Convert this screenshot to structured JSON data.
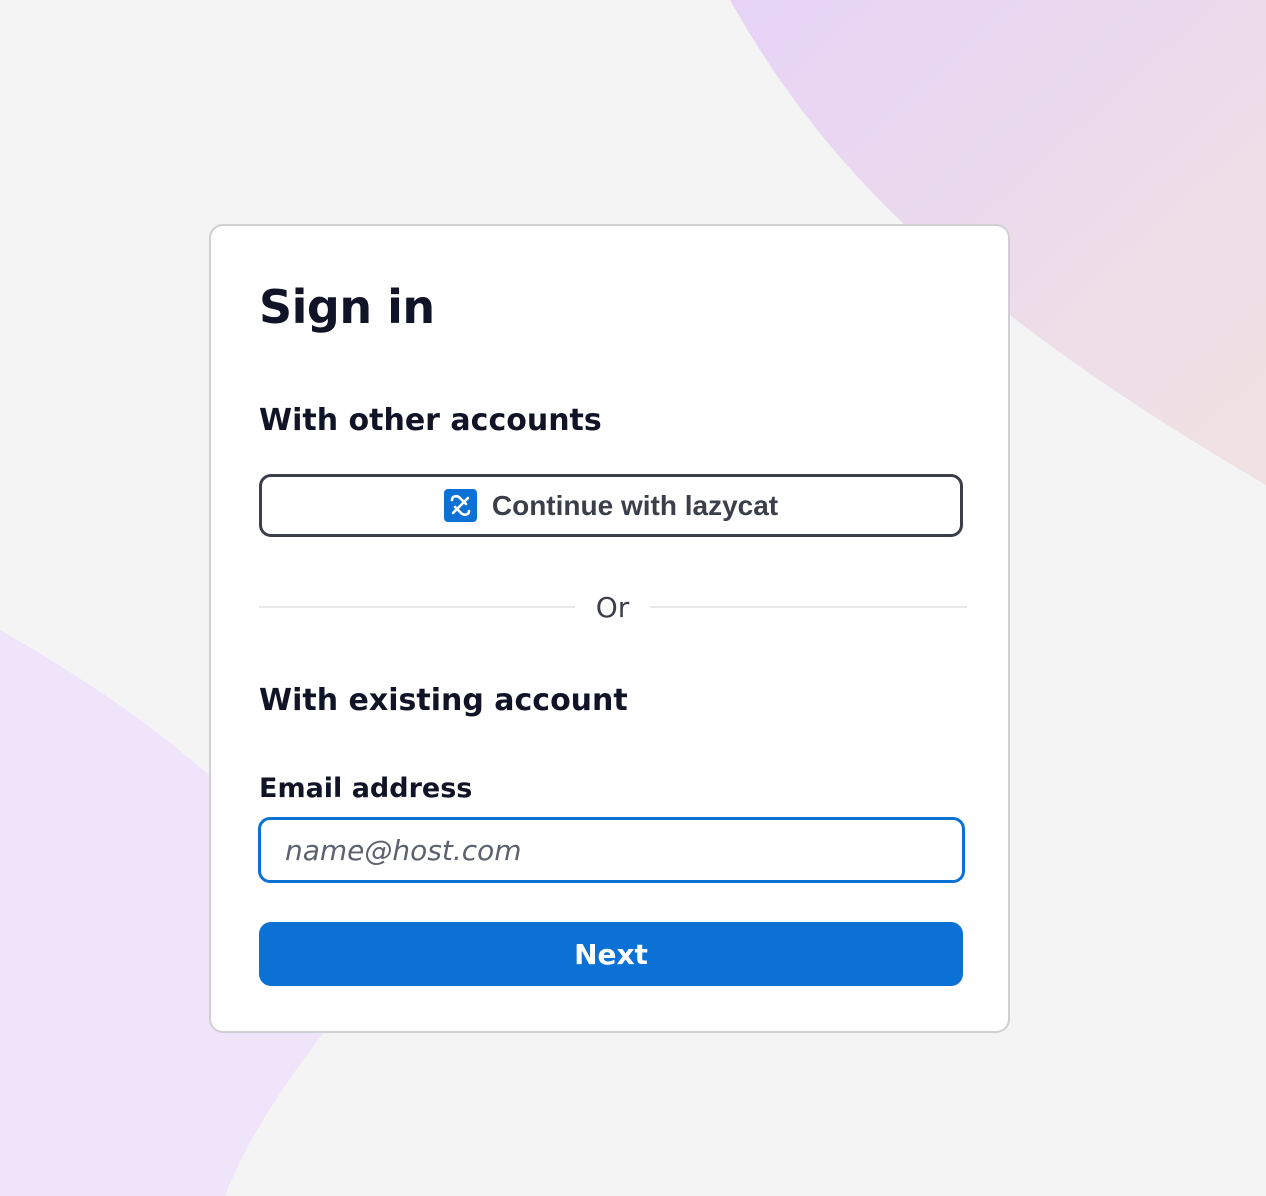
{
  "page": {
    "title": "Sign in"
  },
  "other_accounts": {
    "heading": "With other accounts",
    "provider_button_label": "Continue with lazycat",
    "provider_icon": "lazycat-logo-icon"
  },
  "divider": {
    "text": "Or"
  },
  "existing_account": {
    "heading": "With existing account",
    "email_label": "Email address",
    "email_placeholder": "name@host.com",
    "email_value": "",
    "next_label": "Next"
  },
  "colors": {
    "primary": "#0b71d4",
    "text_dark": "#101426",
    "text_muted": "#3c3f4a",
    "background": "#f4f4f4",
    "blob_top_right": "#e6d6f6",
    "blob_bottom_left": "#f0e4fb"
  }
}
